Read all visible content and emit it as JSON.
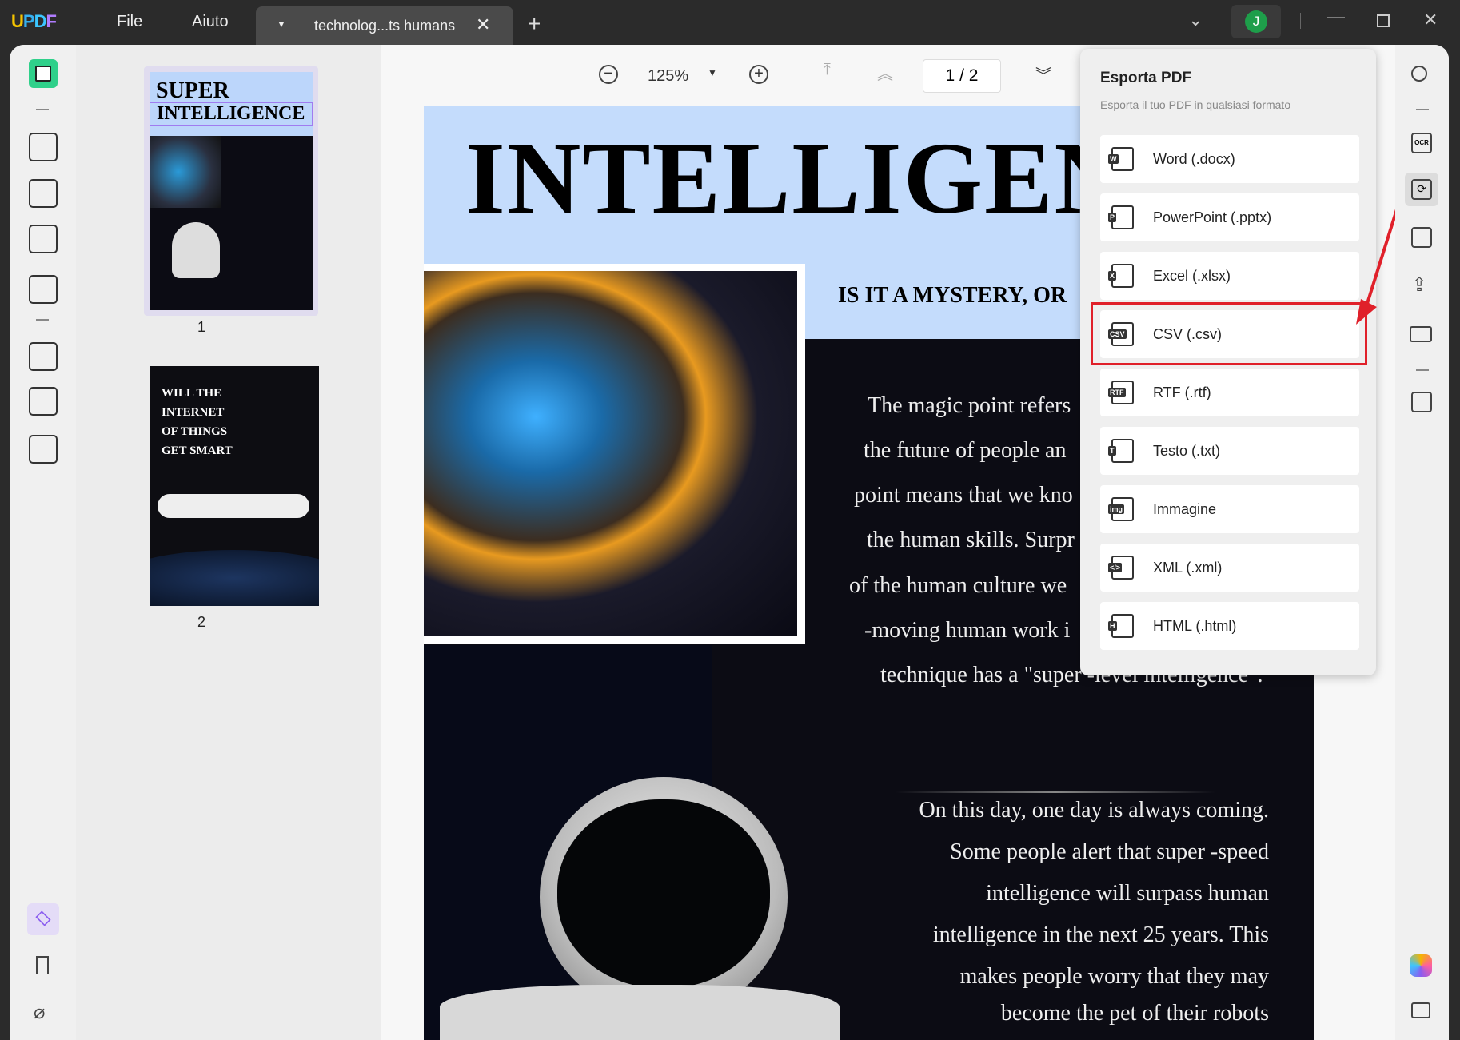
{
  "app": {
    "logo": "UPDF",
    "menu": [
      "File",
      "Aiuto"
    ],
    "tab_title": "technolog...ts humans",
    "avatar": "J"
  },
  "toolbar": {
    "zoom": "125%",
    "page_current": "1",
    "page_sep": "/",
    "page_total": "2"
  },
  "thumbnails": [
    {
      "label": "1",
      "title1": "SUPER",
      "title2": "INTELLIGENCE"
    },
    {
      "label": "2",
      "title": "WILL THE INTERNET OF THINGS GET SMART"
    }
  ],
  "document": {
    "headline": "INTELLIGEN",
    "subhead": "IS IT A MYSTERY, OR",
    "para1": [
      "The magic point refers",
      "the future of people an",
      "point means that we kno",
      "the human skills. Surpr",
      "of the human culture we",
      "-moving human work i",
      "technique has a \"super -level intelligence\"."
    ],
    "para2": [
      "On this day, one day is always coming.",
      "Some people alert that super -speed",
      "intelligence will surpass human",
      "intelligence in the next 25 years. This",
      "makes people worry that they may",
      "become the pet of their robots"
    ]
  },
  "export_panel": {
    "title": "Esporta PDF",
    "subtitle": "Esporta il tuo PDF in qualsiasi formato",
    "options": [
      {
        "label": "Word (.docx)",
        "icon": "W"
      },
      {
        "label": "PowerPoint (.pptx)",
        "icon": "P"
      },
      {
        "label": "Excel (.xlsx)",
        "icon": "X"
      },
      {
        "label": "CSV (.csv)",
        "icon": "CSV",
        "highlighted": true
      },
      {
        "label": "RTF (.rtf)",
        "icon": "RTF"
      },
      {
        "label": "Testo (.txt)",
        "icon": "T"
      },
      {
        "label": "Immagine",
        "icon": "img"
      },
      {
        "label": "XML (.xml)",
        "icon": "</>"
      },
      {
        "label": "HTML (.html)",
        "icon": "H"
      }
    ]
  },
  "colors": {
    "highlight": "#e0202a",
    "accent": "#2fd08a",
    "titlebar": "#2b2b2b"
  }
}
